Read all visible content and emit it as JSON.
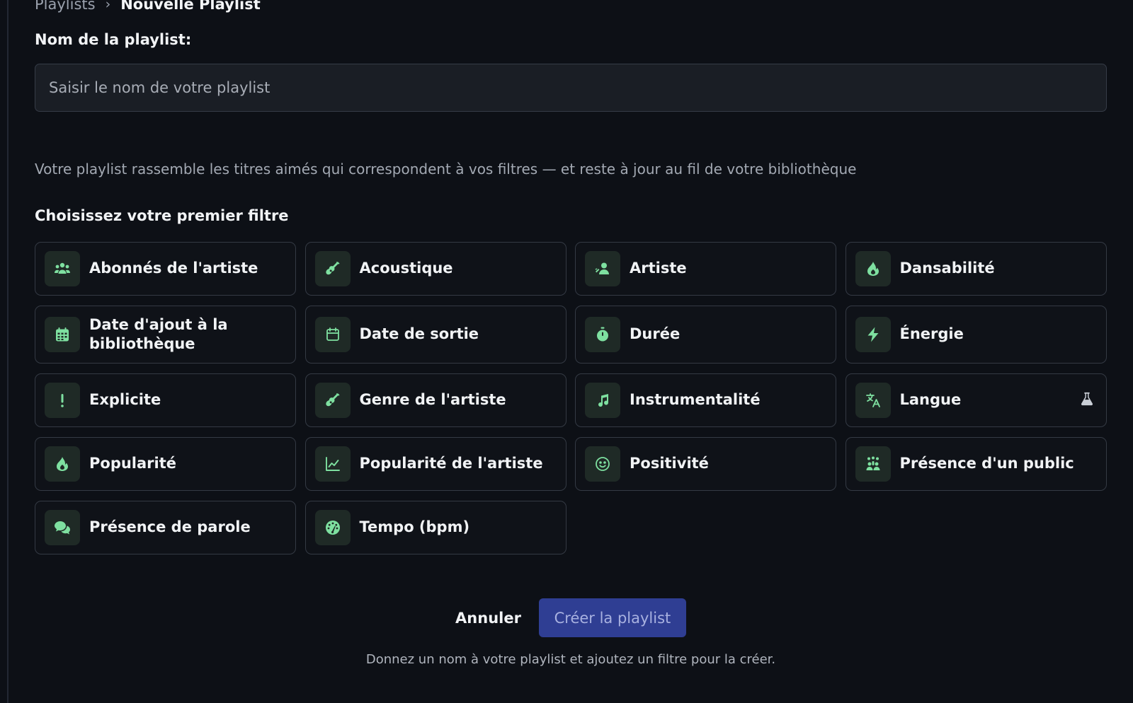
{
  "breadcrumb": {
    "parent": "Playlists",
    "separator": "›",
    "current": "Nouvelle Playlist"
  },
  "form": {
    "name_label": "Nom de la playlist:",
    "name_placeholder": "Saisir le nom de votre playlist",
    "name_value": ""
  },
  "description": "Votre playlist rassemble les titres aimés qui correspondent à vos filtres — et reste à jour au fil de votre bibliothèque",
  "filters_title": "Choisissez votre premier filtre",
  "filters": [
    {
      "label": "Abonnés de l'artiste",
      "icon": "users-icon"
    },
    {
      "label": "Acoustique",
      "icon": "guitar-icon"
    },
    {
      "label": "Artiste",
      "icon": "artist-icon"
    },
    {
      "label": "Dansabilité",
      "icon": "flame-icon"
    },
    {
      "label": "Date d'ajout à la bibliothèque",
      "icon": "calendar-filled-icon"
    },
    {
      "label": "Date de sortie",
      "icon": "calendar-outline-icon"
    },
    {
      "label": "Durée",
      "icon": "stopwatch-icon"
    },
    {
      "label": "Énergie",
      "icon": "bolt-icon"
    },
    {
      "label": "Explicite",
      "icon": "exclamation-icon"
    },
    {
      "label": "Genre de l'artiste",
      "icon": "guitar-icon"
    },
    {
      "label": "Instrumentalité",
      "icon": "music-note-icon"
    },
    {
      "label": "Langue",
      "icon": "translate-icon",
      "badge": "flask-icon"
    },
    {
      "label": "Popularité",
      "icon": "flame-icon"
    },
    {
      "label": "Popularité de l'artiste",
      "icon": "chart-line-icon"
    },
    {
      "label": "Positivité",
      "icon": "smile-icon"
    },
    {
      "label": "Présence d'un public",
      "icon": "audience-icon"
    },
    {
      "label": "Présence de parole",
      "icon": "speech-icon"
    },
    {
      "label": "Tempo (bpm)",
      "icon": "gauge-icon"
    }
  ],
  "actions": {
    "cancel_label": "Annuler",
    "create_label": "Créer la playlist"
  },
  "hint": "Donnez un nom à votre playlist et ajoutez un filtre pour la créer.",
  "colors": {
    "accent": "#7ee0a0",
    "background": "#0d1016",
    "primary_button": "#2f3e93"
  }
}
